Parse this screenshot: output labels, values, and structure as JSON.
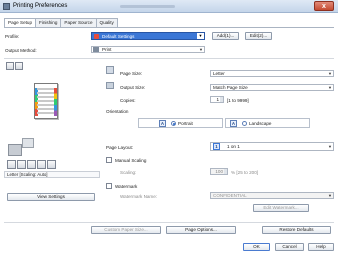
{
  "window": {
    "title": "Printing Preferences",
    "close_symbol": "x"
  },
  "tabs": [
    "Page Setup",
    "Finishing",
    "Paper Source",
    "Quality"
  ],
  "profile": {
    "label": "Profile:",
    "value": "Default Settings",
    "add_label": "Add(1)...",
    "edit_label": "Edit(2)..."
  },
  "output_method": {
    "label": "Output Method:",
    "value": "Print"
  },
  "page_size": {
    "label": "Page Size:",
    "value": "Letter"
  },
  "output_size": {
    "label": "Output Size:",
    "value": "Match Page Size"
  },
  "copies": {
    "label": "Copies:",
    "value": "1",
    "range": "[1 to 9999]"
  },
  "orientation": {
    "label": "Orientation",
    "portrait": "Portrait",
    "landscape": "Landscape",
    "glyph": "A",
    "selected": "Portrait"
  },
  "page_layout": {
    "label": "Page Layout:",
    "value": "1 on 1",
    "glyph": "1"
  },
  "manual_scaling": {
    "label": "Manual Scaling",
    "scaling_label": "Scaling:",
    "scaling_value": "100",
    "scaling_range": "% [25 to 200]"
  },
  "watermark": {
    "label": "Watermark",
    "name_label": "Watermark Name:",
    "name_value": "CONFIDENTIAL",
    "edit_label": "Edit Watermark..."
  },
  "preview": {
    "caption": "Letter [Scaling: Auto]",
    "view_settings_label": "View Settings"
  },
  "bottom": {
    "custom_paper_label": "Custom Paper Size...",
    "page_options_label": "Page Options...",
    "restore_label": "Restore Defaults"
  },
  "footer": {
    "ok_label": "OK",
    "cancel_label": "Cancel",
    "help_label": "Help"
  }
}
